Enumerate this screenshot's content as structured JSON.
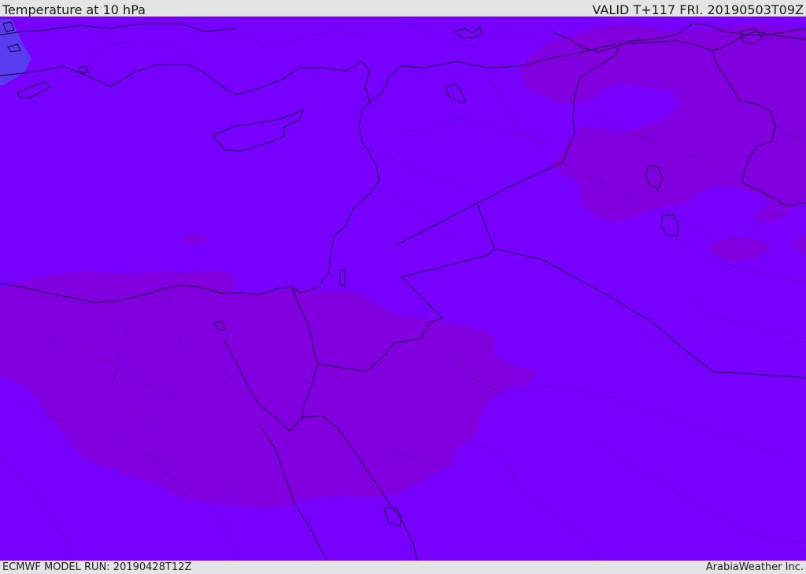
{
  "header": {
    "title": "Temperature at 10 hPa",
    "valid_time": "VALID T+117 FRI. 20190503T09Z"
  },
  "footer": {
    "model_run": "ECMWF MODEL RUN: 20190428T12Z",
    "credit": "ArabiaWeather Inc."
  },
  "map": {
    "field_colors": {
      "base": "#7800fe",
      "warm_region": "#8200e0",
      "cold_patch": "#5a3cf0"
    },
    "line_color": "#1a0040"
  }
}
